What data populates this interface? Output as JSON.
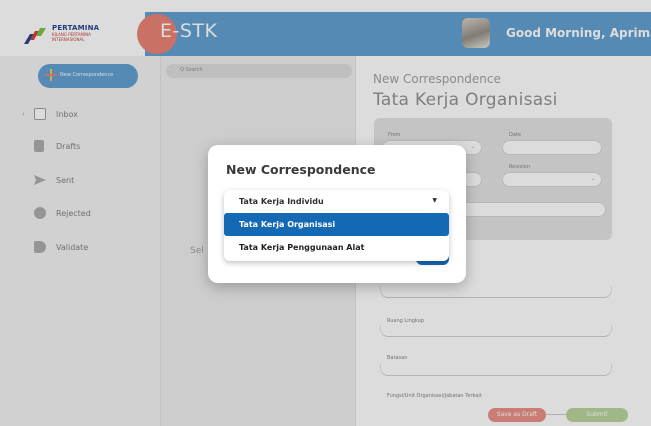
{
  "header": {
    "logo": {
      "title": "PERTAMINA",
      "subtitle_line1": "KILANG PERTAMINA",
      "subtitle_line2": "INTERNASIONAL"
    },
    "brand": "E-STK",
    "greeting": "Good Morning, Aprimal",
    "colors": {
      "topbar": "#5a9ccf",
      "brand_circle": "#e97c6e"
    }
  },
  "sidebar": {
    "new_button": "New Correspondence",
    "items": [
      {
        "label": "Inbox",
        "icon": "inbox-icon"
      },
      {
        "label": "Drafts",
        "icon": "file-icon"
      },
      {
        "label": "Sent",
        "icon": "send-icon"
      },
      {
        "label": "Rejected",
        "icon": "alert-icon"
      },
      {
        "label": "Validate",
        "icon": "tag-icon"
      }
    ]
  },
  "list": {
    "search_placeholder": "Q Search",
    "empty_text": "Sel"
  },
  "main": {
    "breadcrumb": "New Correspondence",
    "title": "Tata Kerja Organisasi",
    "form": {
      "from_label": "From",
      "date_label": "Date",
      "revision_label": "Revision",
      "ruang_lingkup_label": "Ruang Lingkup",
      "batasan_label": "Batasan",
      "fungsi_label": "Fungsi/Unit Organisasi/Jabatan Terkait"
    },
    "save_draft": "Save as Draft",
    "submit": "Submit"
  },
  "modal": {
    "title": "New Correspondence",
    "selected": "Tata Kerja Individu",
    "options": [
      "Tata Kerja Organisasi",
      "Tata Kerja Penggunaan Alat"
    ],
    "active_color": "#1469b5"
  }
}
